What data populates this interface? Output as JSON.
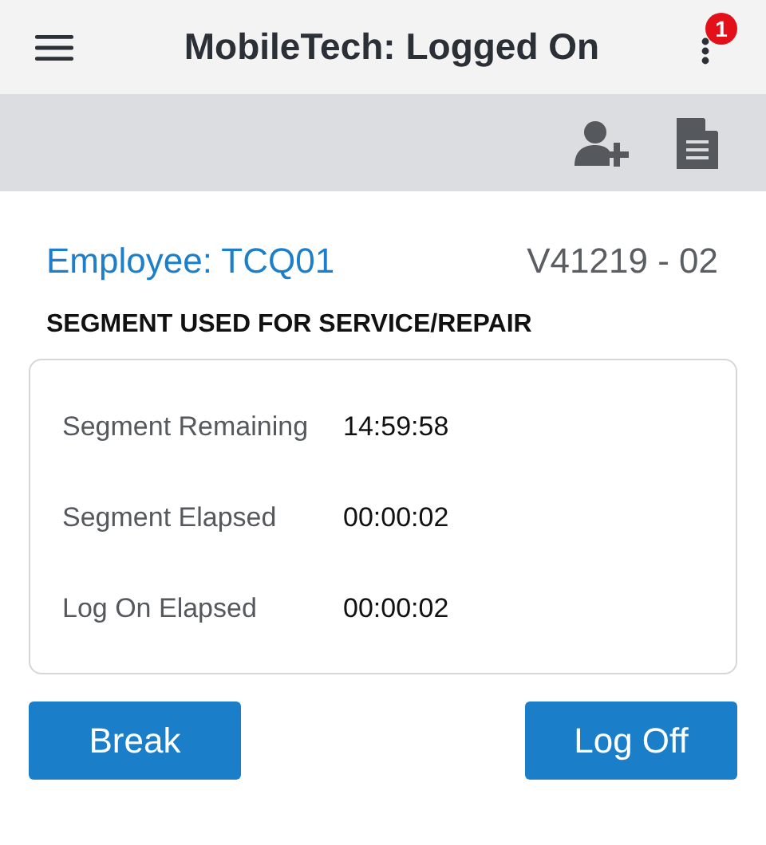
{
  "header": {
    "title": "MobileTech: Logged On",
    "notification_count": "1"
  },
  "employee": {
    "label": "Employee: TCQ01",
    "vehicle": "V41219 - 02"
  },
  "section_title": "SEGMENT USED FOR SERVICE/REPAIR",
  "timers": [
    {
      "label": "Segment Remaining",
      "value": "14:59:58"
    },
    {
      "label": "Segment Elapsed",
      "value": "00:00:02"
    },
    {
      "label": "Log On Elapsed",
      "value": "00:00:02"
    }
  ],
  "buttons": [
    "Break",
    "Log Off"
  ]
}
